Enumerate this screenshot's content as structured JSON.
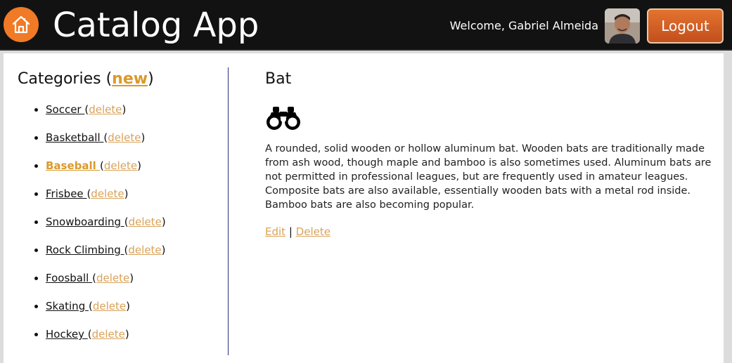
{
  "header": {
    "title": "Catalog App",
    "welcome": "Welcome, Gabriel Almeida",
    "logout_label": "Logout"
  },
  "sidebar": {
    "heading_prefix": "Categories (",
    "new_label": "new",
    "heading_suffix": ")",
    "items": [
      {
        "name": "Soccer ",
        "delete": "delete",
        "active": false
      },
      {
        "name": "Basketball ",
        "delete": "delete",
        "active": false
      },
      {
        "name": "Baseball ",
        "delete": "delete",
        "active": true
      },
      {
        "name": "Frisbee ",
        "delete": "delete",
        "active": false
      },
      {
        "name": "Snowboarding ",
        "delete": "delete",
        "active": false
      },
      {
        "name": "Rock Climbing ",
        "delete": "delete",
        "active": false
      },
      {
        "name": "Foosball ",
        "delete": "delete",
        "active": false
      },
      {
        "name": "Skating ",
        "delete": "delete",
        "active": false
      },
      {
        "name": "Hockey ",
        "delete": "delete",
        "active": false
      }
    ]
  },
  "item": {
    "title": "Bat",
    "icon": "binoculars-icon",
    "description": "A rounded, solid wooden or hollow aluminum bat. Wooden bats are traditionally made from ash wood, though maple and bamboo is also sometimes used. Aluminum bats are not permitted in professional leagues, but are frequently used in amateur leagues. Composite bats are also available, essentially wooden bats with a metal rod inside. Bamboo bats are also becoming popular.",
    "edit_label": "Edit",
    "separator": "|",
    "delete_label": "Delete"
  },
  "colors": {
    "accent": "#d99a2b",
    "header_bg": "#121212",
    "logout_bg": "#c24f1d",
    "home_bg": "#f07a25",
    "divider": "#27307a"
  }
}
